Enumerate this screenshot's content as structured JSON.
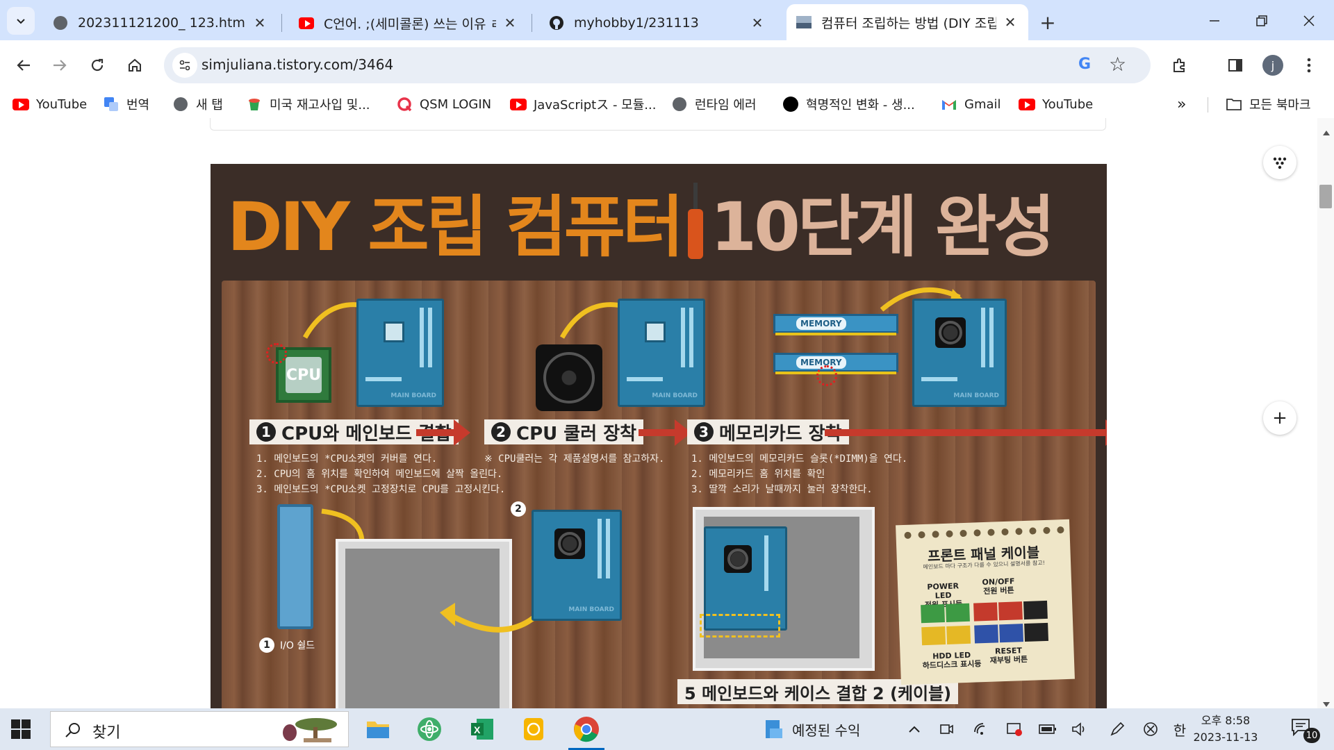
{
  "browser": {
    "tabs": [
      {
        "title": "202311121200_ 123.html",
        "icon": "globe-icon"
      },
      {
        "title": "C언어. ;(세미콜론) 쓰는 이유 ㄹ",
        "icon": "youtube-icon"
      },
      {
        "title": "myhobby1/231113",
        "icon": "github-icon"
      },
      {
        "title": "컴퓨터 조립하는 방법 (DIY 조립",
        "icon": "page-thumbnail-icon",
        "active": true
      }
    ],
    "url": "simjuliana.tistory.com/3464",
    "profile_initial": "j",
    "bookmarks": [
      {
        "label": "YouTube",
        "icon": "youtube-icon"
      },
      {
        "label": "번역",
        "icon": "translate-icon"
      },
      {
        "label": "새 탭",
        "icon": "globe-icon"
      },
      {
        "label": "미국 재고사입 및...",
        "icon": "cup-icon"
      },
      {
        "label": "QSM LOGIN",
        "icon": "q-icon"
      },
      {
        "label": "JavaScriptス - 모듈...",
        "icon": "youtube-icon"
      },
      {
        "label": "런타임 에러",
        "icon": "globe-icon"
      },
      {
        "label": "혁명적인 변화 - 생...",
        "icon": "circle-icon"
      },
      {
        "label": "Gmail",
        "icon": "gmail-icon"
      },
      {
        "label": "YouTube",
        "icon": "youtube-icon"
      }
    ],
    "all_bookmarks": "모든 북마크"
  },
  "poster": {
    "title_a": "DIY 조립 컴퓨터",
    "title_b": "10단계 완성",
    "steps": [
      {
        "num": "1",
        "label": "CPU와 메인보드 결합",
        "desc": [
          "1. 메인보드의 *CPU소켓의 커버를 연다.",
          "2. CPU의 홈 위치를 확인하여 메인보드에 살짝 올린다.",
          "3. 메인보드의 *CPU소켓 고정장치로 CPU를 고정시킨다."
        ]
      },
      {
        "num": "2",
        "label": "CPU 쿨러 장착",
        "desc": [
          "※ CPU쿨러는 각 제품설명서를 참고하자."
        ]
      },
      {
        "num": "3",
        "label": "메모리카드 장착",
        "desc": [
          "1. 메인보드의 메모리카드 슬롯(*DIMM)을 연다.",
          "2. 메모리카드 홈 위치를 확인",
          "3. 딸깍 소리가 날때까지 눌러 장착한다."
        ]
      }
    ],
    "cpu_text": "CPU",
    "memory_text": "MEMORY",
    "mainboard_text": "MAIN BOARD",
    "io_num": "1",
    "io_label": "I/O 쉴드",
    "sub_num": "2",
    "step5_partial": "5 메인보드와 케이스 결합 2 (케이블)",
    "note": {
      "title": "프론트 패널 케이블",
      "subtitle": "메인보드 마다 구조가 다를 수 있으니 설명서를 참고!",
      "power_led": "POWER LED\n전원 표시등",
      "onoff": "ON/OFF\n전원 버튼",
      "hdd_led": "HDD LED\n하드디스크 표시등",
      "reset": "RESET\n재부팅 버튼"
    }
  },
  "taskbar": {
    "search_label": "찾기",
    "weather": "예정된 수익",
    "ime": "한",
    "time": "오후 8:58",
    "date": "2023-11-13",
    "notification_count": "10"
  },
  "colors": {
    "tabstrip": "#d3e3fd",
    "poster_bg": "#3b2d27",
    "title_orange": "#e3861c",
    "title_beige": "#dcb39a",
    "arrow_red": "#c63a2c"
  }
}
